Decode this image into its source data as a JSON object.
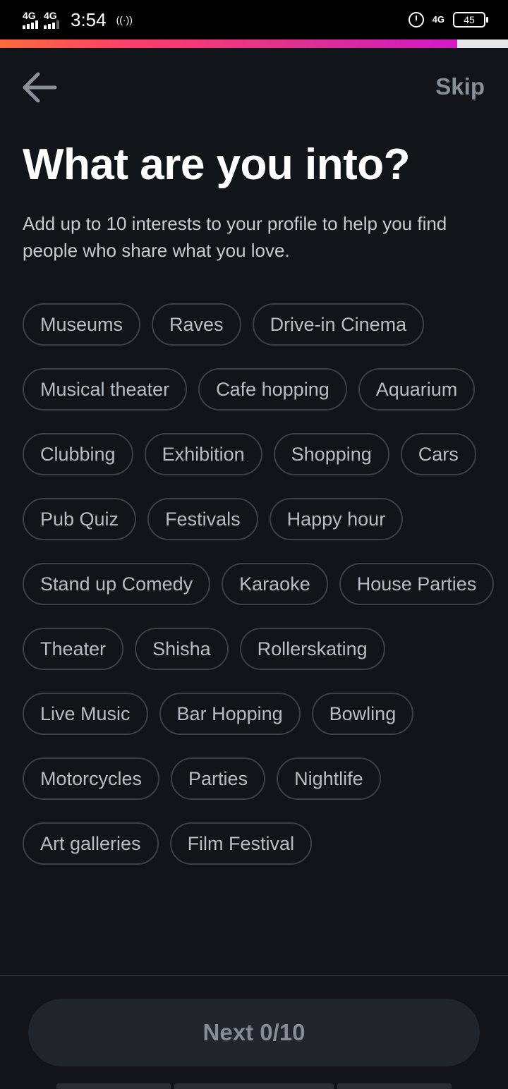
{
  "status_bar": {
    "signal1": "4G",
    "signal2": "4G",
    "time": "3:54",
    "hotspot": "((·))",
    "network": "4G",
    "battery": "45"
  },
  "onboarding_progress": 0.9,
  "nav": {
    "back_icon": "arrow-left-icon",
    "skip_label": "Skip"
  },
  "header": {
    "title": "What are you into?",
    "subtitle": "Add up to 10 interests to your profile to help you find people who share what you love."
  },
  "interests": [
    "Museums",
    "Raves",
    "Drive-in Cinema",
    "Musical theater",
    "Cafe hopping",
    "Aquarium",
    "Clubbing",
    "Exhibition",
    "Shopping",
    "Cars",
    "Pub Quiz",
    "Festivals",
    "Happy hour",
    "Stand up Comedy",
    "Karaoke",
    "House Parties",
    "Theater",
    "Shisha",
    "Rollerskating",
    "Live Music",
    "Bar Hopping",
    "Bowling",
    "Motorcycles",
    "Parties",
    "Nightlife",
    "Art galleries",
    "Film Festival"
  ],
  "footer": {
    "next_label": "Next 0/10"
  },
  "colors": {
    "background": "#111418",
    "chip_border": "#3b4149",
    "chip_text": "#b7bdc5",
    "progress_gradient_start": "#ff6b3d",
    "progress_gradient_end": "#d419c8"
  }
}
